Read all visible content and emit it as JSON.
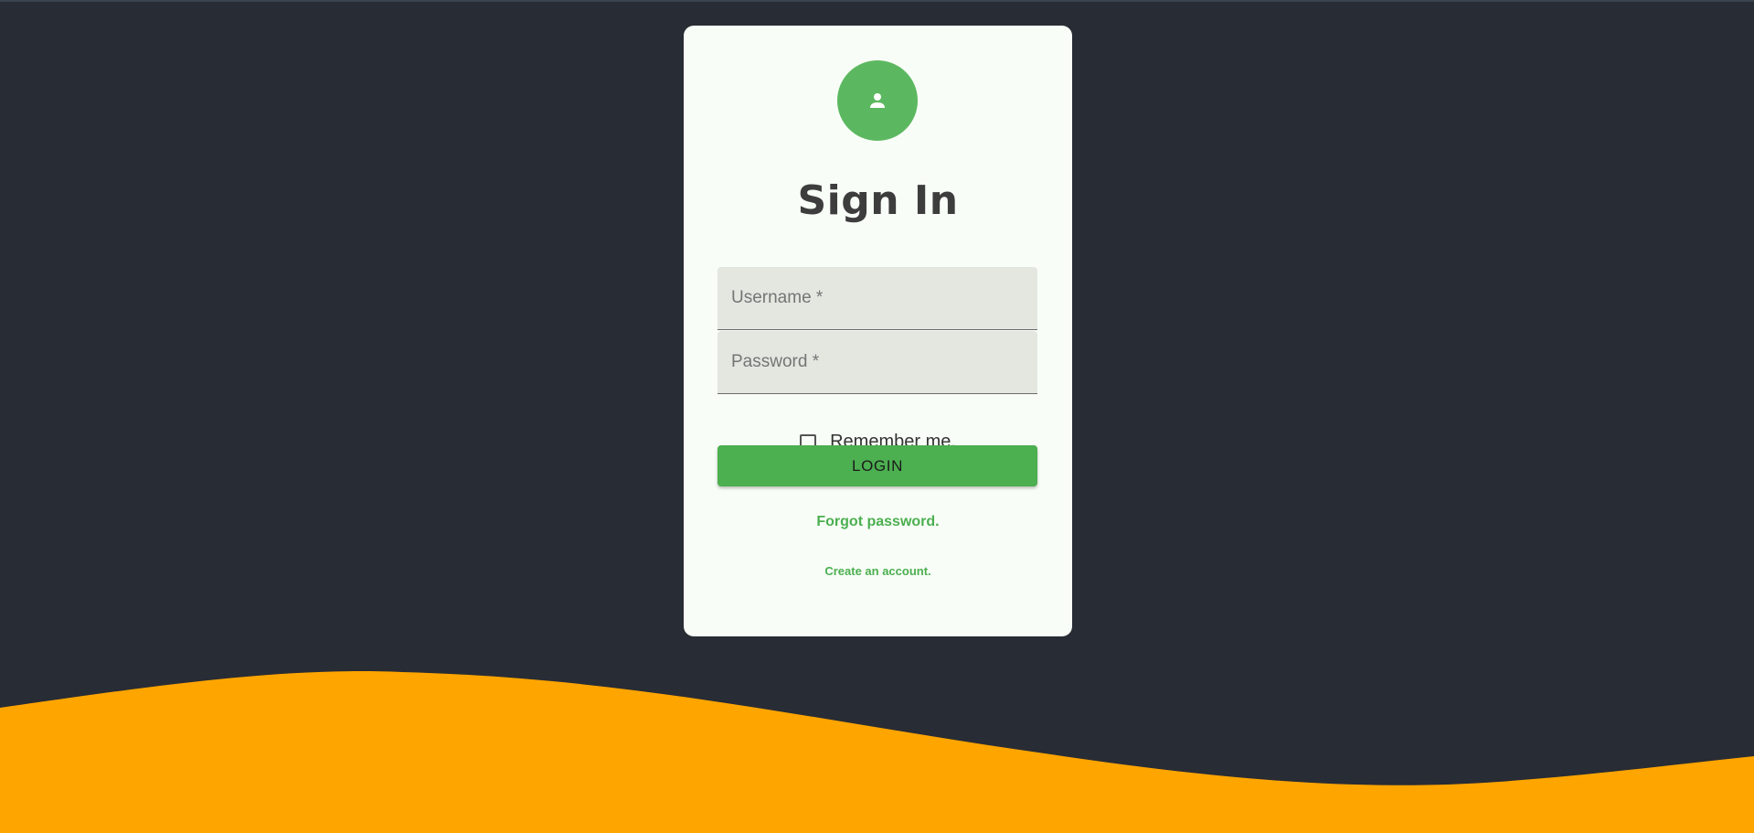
{
  "login": {
    "title": "Sign In",
    "username_placeholder": "Username *",
    "password_placeholder": "Password *",
    "remember_label": "Remember me.",
    "login_label": "LOGIN",
    "forgot_label": "Forgot password.",
    "create_label": "Create an account."
  },
  "colors": {
    "background": "#282c34",
    "card": "#f8fdf7",
    "accent": "#4caf50",
    "wave": "#ffa500"
  },
  "icons": {
    "avatar": "person-icon"
  }
}
